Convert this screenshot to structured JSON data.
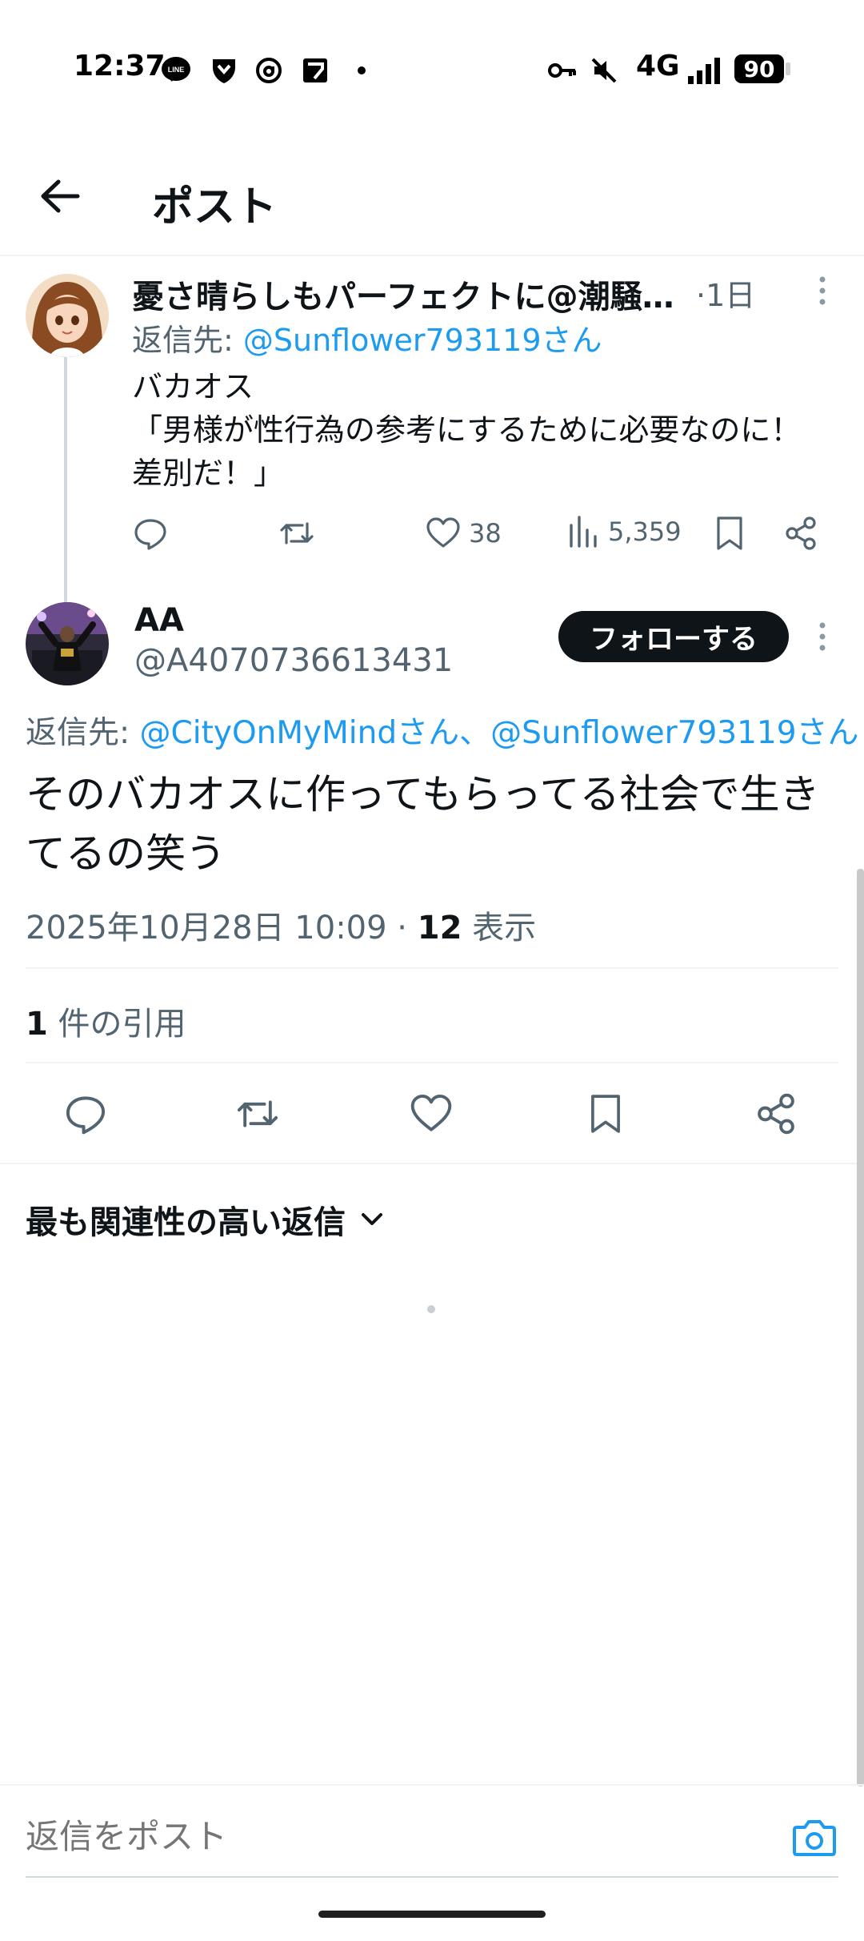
{
  "status_bar": {
    "time": "12:37",
    "network": "4G",
    "battery": "90",
    "icons": [
      "line-icon",
      "shield-icon",
      "threads-icon",
      "news-icon",
      "dot-icon",
      "key-icon",
      "mute-icon",
      "signal-icon"
    ]
  },
  "header": {
    "title": "ポスト"
  },
  "parent_post": {
    "display_name": "憂さ晴らしもパーフェクトに@潮騒…",
    "time": "·1日",
    "reply_prefix": "返信先: ",
    "reply_handle": "@Sunflower793119さん",
    "text": "バカオス\n「男様が性行為の参考にするために必要なのに！差別だ！」",
    "likes": "38",
    "views": "5,359"
  },
  "main_post": {
    "display_name": "AA",
    "handle": "@A4070736613431",
    "follow_label": "フォローする",
    "reply_prefix": "返信先: ",
    "reply_handles": "@CityOnMyMindさん、@Sunflower793119さん",
    "text": "そのバカオスに作ってもらってる社会で生きてるの笑う",
    "datetime": "2025年10月28日 10:09 · ",
    "views_count": "12",
    "views_label": " 表示",
    "quote_count": "1",
    "quote_label": " 件の引用"
  },
  "replies": {
    "sort_label": "最も関連性の高い返信"
  },
  "composer": {
    "placeholder": "返信をポスト"
  },
  "colors": {
    "accent": "#1d9bf0",
    "text_primary": "#0f1419",
    "text_secondary": "#536471",
    "divider": "#eff3f4"
  }
}
